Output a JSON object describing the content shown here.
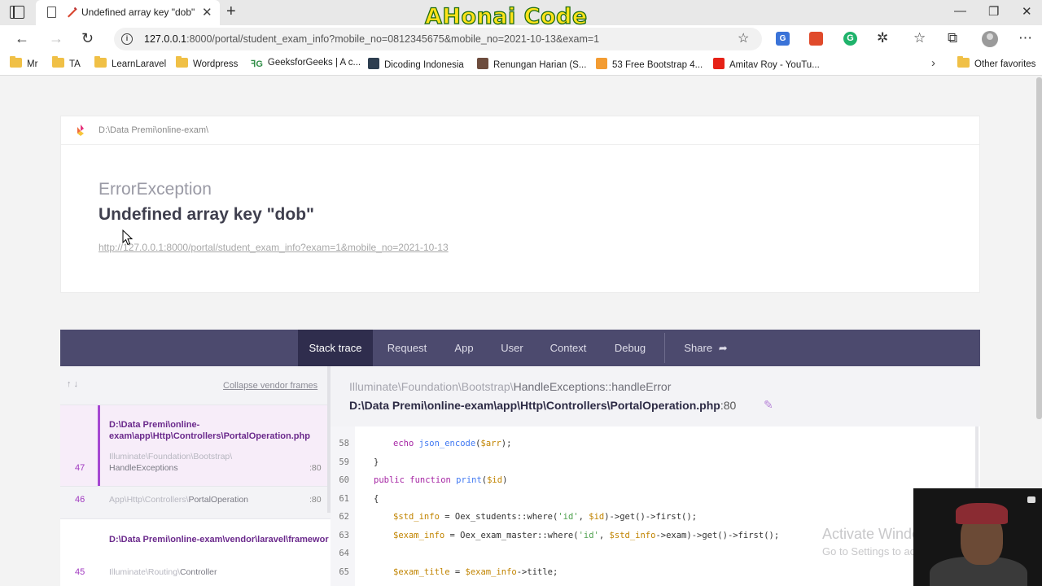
{
  "browser": {
    "tab_title": "Undefined array key \"dob\"",
    "overlay_title": "AHonai Code",
    "url_host": "127.0.0.1",
    "url_rest": ":8000/portal/student_exam_info?mobile_no=0812345675&mobile_no=2021-10-13&exam=1",
    "new_tab_glyph": "+",
    "bookmarks": [
      "Mr",
      "TA",
      "LearnLaravel",
      "Wordpress",
      "GeeksforGeeks | A c...",
      "Dicoding Indonesia",
      "Renungan Harian (S...",
      "53 Free Bootstrap 4...",
      "Amitav Roy - YouTu..."
    ],
    "other_favorites": "Other favorites"
  },
  "error": {
    "project_path": "D:\\Data Premi\\online-exam\\",
    "exception_class": "ErrorException",
    "message": "Undefined array key \"dob\"",
    "url": "http://127.0.0.1:8000/portal/student_exam_info?exam=1&mobile_no=2021-10-13"
  },
  "tabs": {
    "stack_trace": "Stack trace",
    "request": "Request",
    "app": "App",
    "user": "User",
    "context": "Context",
    "debug": "Debug",
    "share": "Share"
  },
  "frames": {
    "collapse_label": "Collapse vendor frames",
    "items": [
      {
        "num": "47",
        "file": "D:\\Data Premi\\online-exam\\app\\Http\\Controllers\\PortalOperation.php",
        "ns": "Illuminate\\Foundation\\Bootstrap\\",
        "cls": "HandleExceptions",
        "line": ":80"
      },
      {
        "num": "46",
        "ns": "App\\Http\\Controllers\\",
        "cls": "PortalOperation",
        "line": ":80"
      },
      {
        "num": "45",
        "file": "D:\\Data Premi\\online-exam\\vendor\\laravel\\framework\\src\\Illuminate\\Routing\\Controller.php",
        "ns": "Illuminate\\Routing\\",
        "cls": "Controller",
        "line": ""
      }
    ]
  },
  "code": {
    "namespace": "Illuminate\\Foundation\\Bootstrap\\",
    "class_method": "HandleExceptions::handleError",
    "file": "D:\\Data Premi\\online-exam\\app\\Http\\Controllers\\PortalOperation.php",
    "line": ":80",
    "lines": [
      {
        "n": "58",
        "indent": 2,
        "code": "echo json_encode($arr);"
      },
      {
        "n": "59",
        "indent": 1,
        "code": "}"
      },
      {
        "n": "60",
        "indent": 1,
        "code": "public function print($id)"
      },
      {
        "n": "61",
        "indent": 1,
        "code": "{"
      },
      {
        "n": "62",
        "indent": 2,
        "code": "$std_info = Oex_students::where('id', $id)->get()->first();"
      },
      {
        "n": "63",
        "indent": 2,
        "code": "$exam_info = Oex_exam_master::where('id', $std_info->exam)->get()->first();"
      },
      {
        "n": "64",
        "indent": 0,
        "code": ""
      },
      {
        "n": "65",
        "indent": 2,
        "code": "$exam_title = $exam_info->title;"
      }
    ]
  },
  "windows": {
    "activate_title": "Activate Windows",
    "activate_sub": "Go to Settings to activate Windows."
  }
}
